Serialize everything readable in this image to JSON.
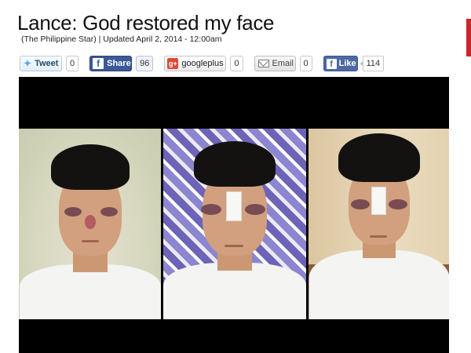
{
  "article": {
    "title": "Lance: God restored my face",
    "byline": "(The Philippine Star) | Updated April 2, 2014 - 12:00am"
  },
  "share_bar": {
    "twitter": {
      "label": "Tweet",
      "count": "0"
    },
    "facebook_share": {
      "label": "Share",
      "count": "96"
    },
    "googleplus": {
      "label": "googleplus",
      "icon_text": "g+",
      "count": "0"
    },
    "email": {
      "label": "Email",
      "count": "0"
    },
    "facebook_like": {
      "label": "Like",
      "count": "114"
    }
  },
  "colors": {
    "facebook": "#3b5998",
    "twitter": "#55acee",
    "googleplus": "#dd4b39",
    "accent": "#c9262c"
  },
  "icons": [
    "twitter-bird-icon",
    "facebook-f-icon",
    "googleplus-icon",
    "email-envelope-icon",
    "facebook-like-icon"
  ]
}
